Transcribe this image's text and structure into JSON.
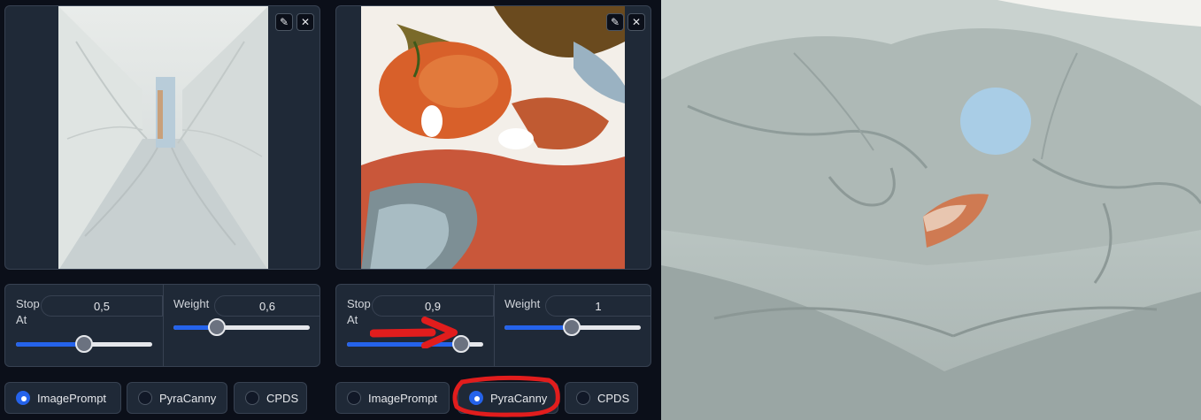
{
  "slot1": {
    "image_alt": "",
    "edit_icon": "pencil-icon",
    "close_icon": "x-icon",
    "stop_at_label": "Stop At",
    "stop_at_value": "0,5",
    "stop_at_fraction": 0.5,
    "weight_label": "Weight",
    "weight_value": "0,6",
    "weight_fraction": 0.31,
    "options": [
      "ImagePrompt",
      "PyraCanny",
      "CPDS"
    ],
    "selected": "ImagePrompt"
  },
  "slot2": {
    "edit_icon": "pencil-icon",
    "close_icon": "x-icon",
    "stop_at_label": "Stop At",
    "stop_at_value": "0,9",
    "stop_at_fraction": 0.9,
    "weight_label": "Weight",
    "weight_value": "1",
    "weight_fraction": 0.5,
    "options": [
      "ImagePrompt",
      "PyraCanny",
      "CPDS"
    ],
    "selected": "PyraCanny"
  },
  "colors": {
    "background": "#0b0f19",
    "panel": "#1f2937",
    "accent": "#2563eb",
    "annotation": "#e11d1d"
  }
}
